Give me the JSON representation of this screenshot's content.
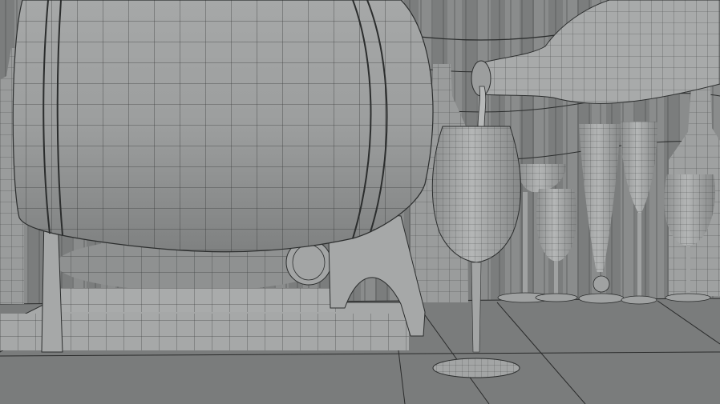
{
  "scene": {
    "render_style": "wireframe-over-gray-shaded",
    "colors": {
      "background": "#6f7171",
      "floor": "#7a7c7c",
      "floor_line": "#2a2b2b",
      "curtain": "#8a8c8c",
      "curtain_shadow": "#5e6060",
      "object_fill": "#9a9c9c",
      "object_fill_light": "#b0b2b2",
      "object_fill_dark": "#7a7c7c",
      "wire": "#2b2d2d",
      "stand": "#a6a8a8"
    },
    "objects": [
      {
        "name": "wooden-barrel",
        "icon": "barrel"
      },
      {
        "name": "small-barrel",
        "icon": "barrel"
      },
      {
        "name": "barrel-stand",
        "icon": "stand"
      },
      {
        "name": "wine-bottle-pouring",
        "icon": "bottle"
      },
      {
        "name": "wine-stream",
        "icon": "stream"
      },
      {
        "name": "wine-glass-front",
        "icon": "wine-glass"
      },
      {
        "name": "coupe-glass",
        "icon": "coupe-glass"
      },
      {
        "name": "tulip-glass",
        "icon": "wine-glass"
      },
      {
        "name": "tall-pilsner-glass",
        "icon": "pilsner-glass"
      },
      {
        "name": "champagne-flute",
        "icon": "flute"
      },
      {
        "name": "small-wine-glass-right",
        "icon": "wine-glass"
      },
      {
        "name": "background-bottle-left",
        "icon": "bottle"
      },
      {
        "name": "background-bottle-center",
        "icon": "bottle"
      },
      {
        "name": "background-bottle-right",
        "icon": "bottle"
      },
      {
        "name": "curtain-backdrop",
        "icon": "curtain"
      },
      {
        "name": "tiled-floor",
        "icon": "floor"
      }
    ]
  }
}
